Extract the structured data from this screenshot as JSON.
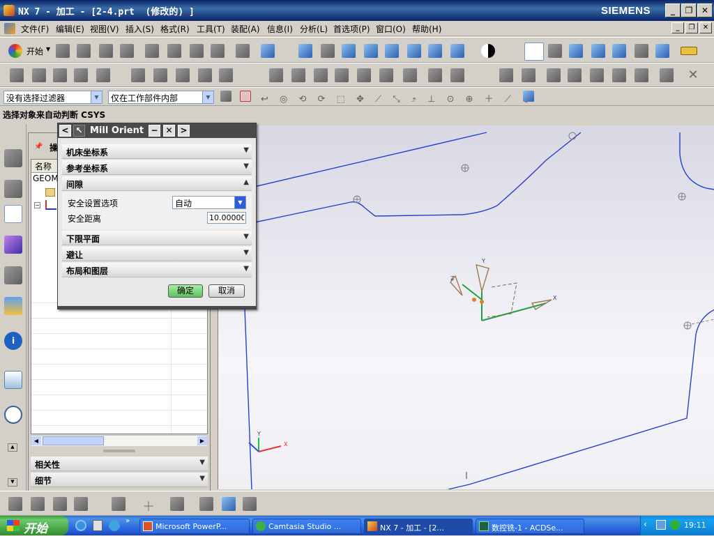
{
  "window": {
    "title": "NX 7 - 加工 - [2-4.prt  (修改的) ]",
    "brand": "SIEMENS"
  },
  "menu": [
    "文件(F)",
    "编辑(E)",
    "视图(V)",
    "插入(S)",
    "格式(R)",
    "工具(T)",
    "装配(A)",
    "信息(I)",
    "分析(L)",
    "首选项(P)",
    "窗口(O)",
    "帮助(H)"
  ],
  "toolbar": {
    "start_label": "开始",
    "filter_select": "没有选择过滤器",
    "scope_select": "仅在工作部件内部"
  },
  "cue_line": "选择对象来自动判断 CSYS",
  "navigator": {
    "header_initial": "操",
    "column_name": "名称",
    "row_geom": "GEOM",
    "sections": [
      "相关性",
      "细节"
    ]
  },
  "dialog": {
    "title": "Mill Orient",
    "sections": {
      "mcs": "机床坐标系",
      "ref": "参考坐标系",
      "clearance": "间隙",
      "lower_plane": "下限平面",
      "avoidance": "避让",
      "layout": "布局和图层"
    },
    "clearance_option_label": "安全设置选项",
    "clearance_option_value": "自动",
    "safe_distance_label": "安全距离",
    "safe_distance_value": "10.00000",
    "ok": "确定",
    "cancel": "取消"
  },
  "graphics": {
    "axis_labels": {
      "x": "X",
      "y": "Y",
      "z": "Z"
    }
  },
  "taskbar": {
    "start": "开始",
    "tasks": [
      "Microsoft PowerP...",
      "Camtasia Studio ...",
      "NX 7 - 加工 - [2...",
      "数控铣-1 - ACDSe..."
    ],
    "clock": "19:11"
  },
  "colors": {
    "curve": "#2040d0",
    "ok_button": "#7cd67c",
    "taskbar": "#245edb",
    "dialog_title": "#4a4a4a"
  }
}
